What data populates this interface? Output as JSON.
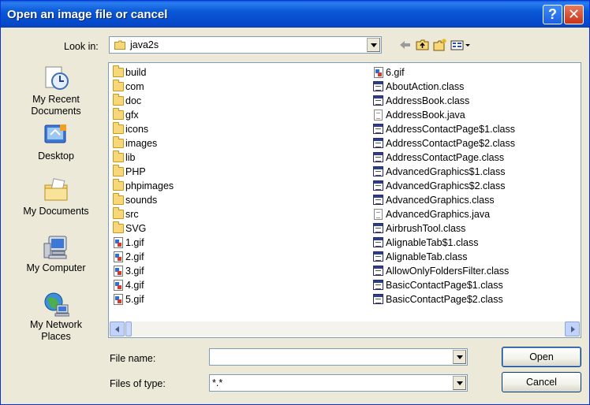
{
  "window": {
    "title": "Open an image file or cancel",
    "help_glyph": "?",
    "close_glyph": "✕"
  },
  "lookin": {
    "label": "Look in:",
    "value": "java2s"
  },
  "places": [
    {
      "label_line1": "My Recent",
      "label_line2": "Documents",
      "icon": "recent-documents-icon"
    },
    {
      "label_line1": "Desktop",
      "label_line2": "",
      "icon": "desktop-icon"
    },
    {
      "label_line1": "My Documents",
      "label_line2": "",
      "icon": "my-documents-icon"
    },
    {
      "label_line1": "My Computer",
      "label_line2": "",
      "icon": "my-computer-icon"
    },
    {
      "label_line1": "My Network",
      "label_line2": "Places",
      "icon": "network-places-icon"
    }
  ],
  "files": {
    "column1": [
      {
        "name": "build",
        "type": "folder"
      },
      {
        "name": "com",
        "type": "folder"
      },
      {
        "name": "doc",
        "type": "folder"
      },
      {
        "name": "gfx",
        "type": "folder"
      },
      {
        "name": "icons",
        "type": "folder"
      },
      {
        "name": "images",
        "type": "folder"
      },
      {
        "name": "lib",
        "type": "folder"
      },
      {
        "name": "PHP",
        "type": "folder"
      },
      {
        "name": "phpimages",
        "type": "folder"
      },
      {
        "name": "sounds",
        "type": "folder"
      },
      {
        "name": "src",
        "type": "folder"
      },
      {
        "name": "SVG",
        "type": "folder"
      },
      {
        "name": "1.gif",
        "type": "gif"
      },
      {
        "name": "2.gif",
        "type": "gif"
      },
      {
        "name": "3.gif",
        "type": "gif"
      },
      {
        "name": "4.gif",
        "type": "gif"
      },
      {
        "name": "5.gif",
        "type": "gif"
      }
    ],
    "column2": [
      {
        "name": "6.gif",
        "type": "gif"
      },
      {
        "name": "AboutAction.class",
        "type": "class"
      },
      {
        "name": "AddressBook.class",
        "type": "class"
      },
      {
        "name": "AddressBook.java",
        "type": "java"
      },
      {
        "name": "AddressContactPage$1.class",
        "type": "class"
      },
      {
        "name": "AddressContactPage$2.class",
        "type": "class"
      },
      {
        "name": "AddressContactPage.class",
        "type": "class"
      },
      {
        "name": "AdvancedGraphics$1.class",
        "type": "class"
      },
      {
        "name": "AdvancedGraphics$2.class",
        "type": "class"
      },
      {
        "name": "AdvancedGraphics.class",
        "type": "class"
      },
      {
        "name": "AdvancedGraphics.java",
        "type": "java"
      },
      {
        "name": "AirbrushTool.class",
        "type": "class"
      },
      {
        "name": "AlignableTab$1.class",
        "type": "class"
      },
      {
        "name": "AlignableTab.class",
        "type": "class"
      },
      {
        "name": "AllowOnlyFoldersFilter.class",
        "type": "class"
      },
      {
        "name": "BasicContactPage$1.class",
        "type": "class"
      },
      {
        "name": "BasicContactPage$2.class",
        "type": "class"
      }
    ]
  },
  "filename": {
    "label": "File name:",
    "value": ""
  },
  "filetype": {
    "label": "Files of type:",
    "value": "*.*"
  },
  "buttons": {
    "open": "Open",
    "cancel": "Cancel"
  }
}
